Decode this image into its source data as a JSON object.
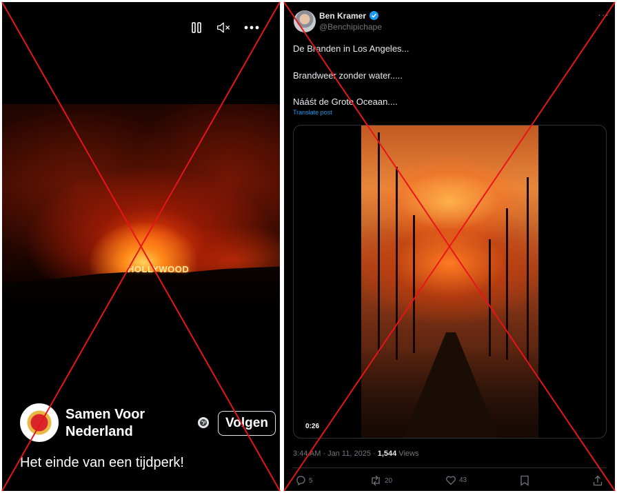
{
  "left_post": {
    "video_overlay_text": "HOLLYWOOD",
    "controls": {
      "pause_icon": "pause-icon",
      "mute_icon": "volume-muted-icon",
      "more_icon": "more-horizontal-icon"
    },
    "page_name": "Samen Voor Nederland",
    "privacy_icon": "globe-icon",
    "follow_label": "Volgen",
    "caption": "Het einde van een tijdperk!"
  },
  "right_post": {
    "author_name": "Ben Kramer",
    "verified_icon": "verified-badge-icon",
    "author_handle": "@Benchipichape",
    "more_icon": "more-horizontal-icon",
    "text_lines": [
      "De Branden in Los Angeles...",
      "Brandweer zonder water.....",
      "Nááśt de Grote Oceaan...."
    ],
    "translate_label": "Translate post",
    "video_time": "0:26",
    "time": "3:44 AM",
    "date": "Jan 11, 2025",
    "views_count": "1,544",
    "views_label": "Views",
    "replies_count": "5",
    "reposts_count": "20",
    "likes_count": "43"
  },
  "colors": {
    "x_accent": "#1d9bf0",
    "strike_red": "#e8141a",
    "panel_bg": "#000000"
  }
}
